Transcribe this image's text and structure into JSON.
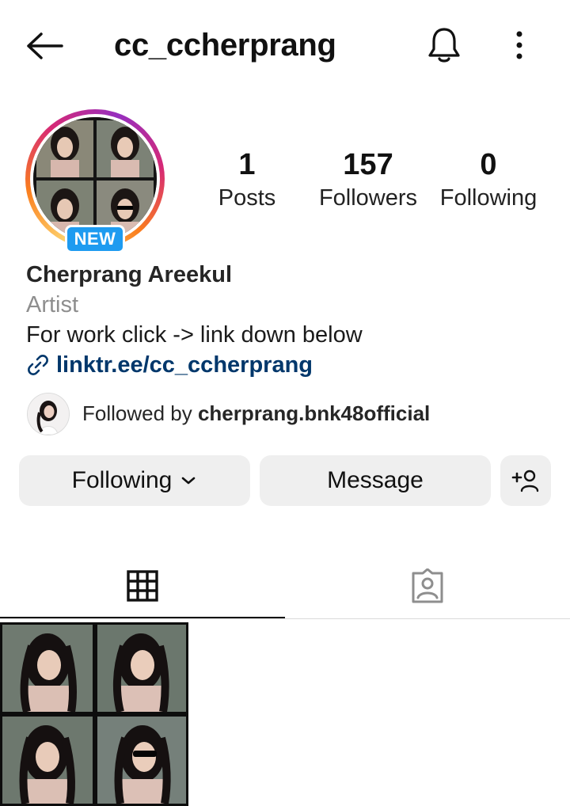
{
  "header": {
    "username": "cc_ccherprang",
    "back_icon": "arrow-left-icon",
    "notification_icon": "bell-icon",
    "more_icon": "more-vertical-icon"
  },
  "profile": {
    "badge": "NEW",
    "stats": [
      {
        "count": "1",
        "label": "Posts"
      },
      {
        "count": "157",
        "label": "Followers"
      },
      {
        "count": "0",
        "label": "Following"
      }
    ],
    "full_name": "Cherprang Areekul",
    "category": "Artist",
    "bio": "For work click -> link down below",
    "link": "linktr.ee/cc_ccherprang"
  },
  "followed_by": {
    "prefix": "Followed by ",
    "username": "cherprang.bnk48official"
  },
  "actions": {
    "following_label": "Following",
    "message_label": "Message"
  },
  "tabs": [
    {
      "icon": "grid-icon",
      "active": true
    },
    {
      "icon": "tagged-icon",
      "active": false
    }
  ],
  "colors": {
    "link": "#00376b",
    "badge": "#1e9bf0",
    "button_bg": "#efefef",
    "secondary_text": "#8e8e8e"
  }
}
